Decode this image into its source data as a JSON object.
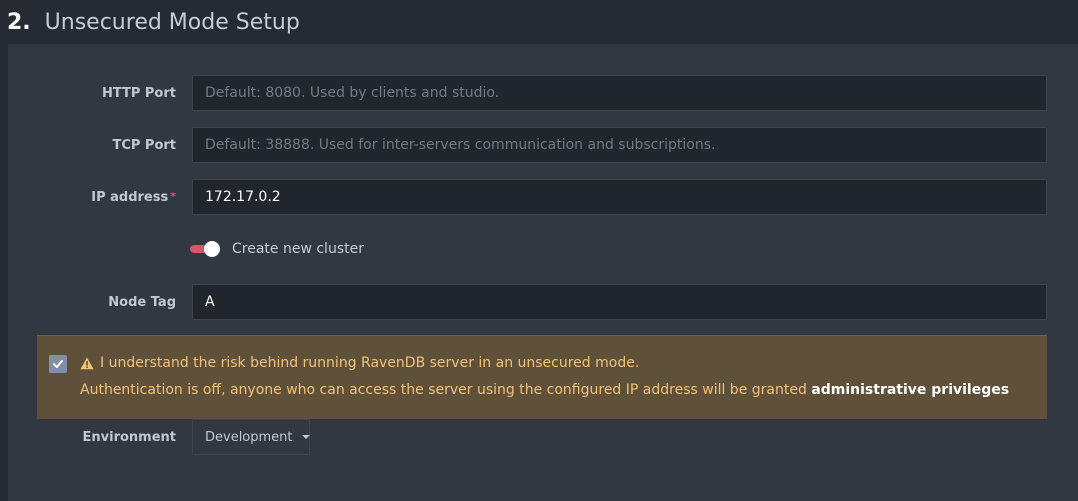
{
  "header": {
    "step_number": "2.",
    "title": "Unsecured Mode Setup"
  },
  "form": {
    "http_port": {
      "label": "HTTP Port",
      "value": "",
      "placeholder": "Default: 8080. Used by clients and studio."
    },
    "tcp_port": {
      "label": "TCP Port",
      "value": "",
      "placeholder": "Default: 38888. Used for inter-servers communication and subscriptions."
    },
    "ip_address": {
      "label": "IP address",
      "required_marker": "*",
      "value": "172.17.0.2",
      "placeholder": ""
    },
    "create_cluster": {
      "label": "Create new cluster",
      "checked": true
    },
    "node_tag": {
      "label": "Node Tag",
      "value": "A"
    },
    "environment": {
      "label": "Environment",
      "selected": "Development"
    }
  },
  "warning": {
    "checked": true,
    "line1": "I understand the risk behind running RavenDB server in an unsecured mode.",
    "line2_prefix": "Authentication is off, anyone who can access the server using the configured IP address will be granted ",
    "line2_strong": "administrative privileges"
  },
  "colors": {
    "accent": "#d9536a",
    "warning_bg": "#5f5039",
    "warning_text": "#f3c27a"
  }
}
